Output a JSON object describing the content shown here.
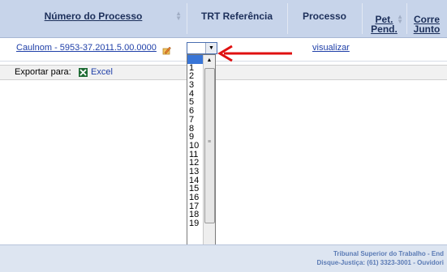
{
  "table": {
    "headers": {
      "numero_processo": "Número do Processo",
      "trt_referencia": "TRT Referência",
      "processo": "Processo",
      "pet_pend_line1": "Pet.",
      "pet_pend_line2": "Pend.",
      "corre_junto_line1": "Corre",
      "corre_junto_line2": "Junto"
    },
    "row": {
      "processo_link": "Caulnom - 5953-37.2011.5.00.0000",
      "trt_select_value": "",
      "visualizar": "visualizar"
    }
  },
  "export": {
    "label": "Exportar para:",
    "excel": "Excel"
  },
  "dropdown": {
    "options": [
      "",
      "1",
      "2",
      "3",
      "4",
      "5",
      "6",
      "7",
      "8",
      "9",
      "10",
      "11",
      "12",
      "13",
      "14",
      "15",
      "16",
      "17",
      "18",
      "19"
    ],
    "selected_index": 0
  },
  "footer": {
    "line1": "Tribunal Superior do Trabalho - End",
    "line2": "Disque-Justiça: (61) 3323-3001 - Ouvidori"
  },
  "colors": {
    "header_bg": "#c7d4ea",
    "link": "#1f3fa8",
    "arrow": "#e01010",
    "selected_option": "#3875d7",
    "footer_bg": "#dde5f1"
  }
}
